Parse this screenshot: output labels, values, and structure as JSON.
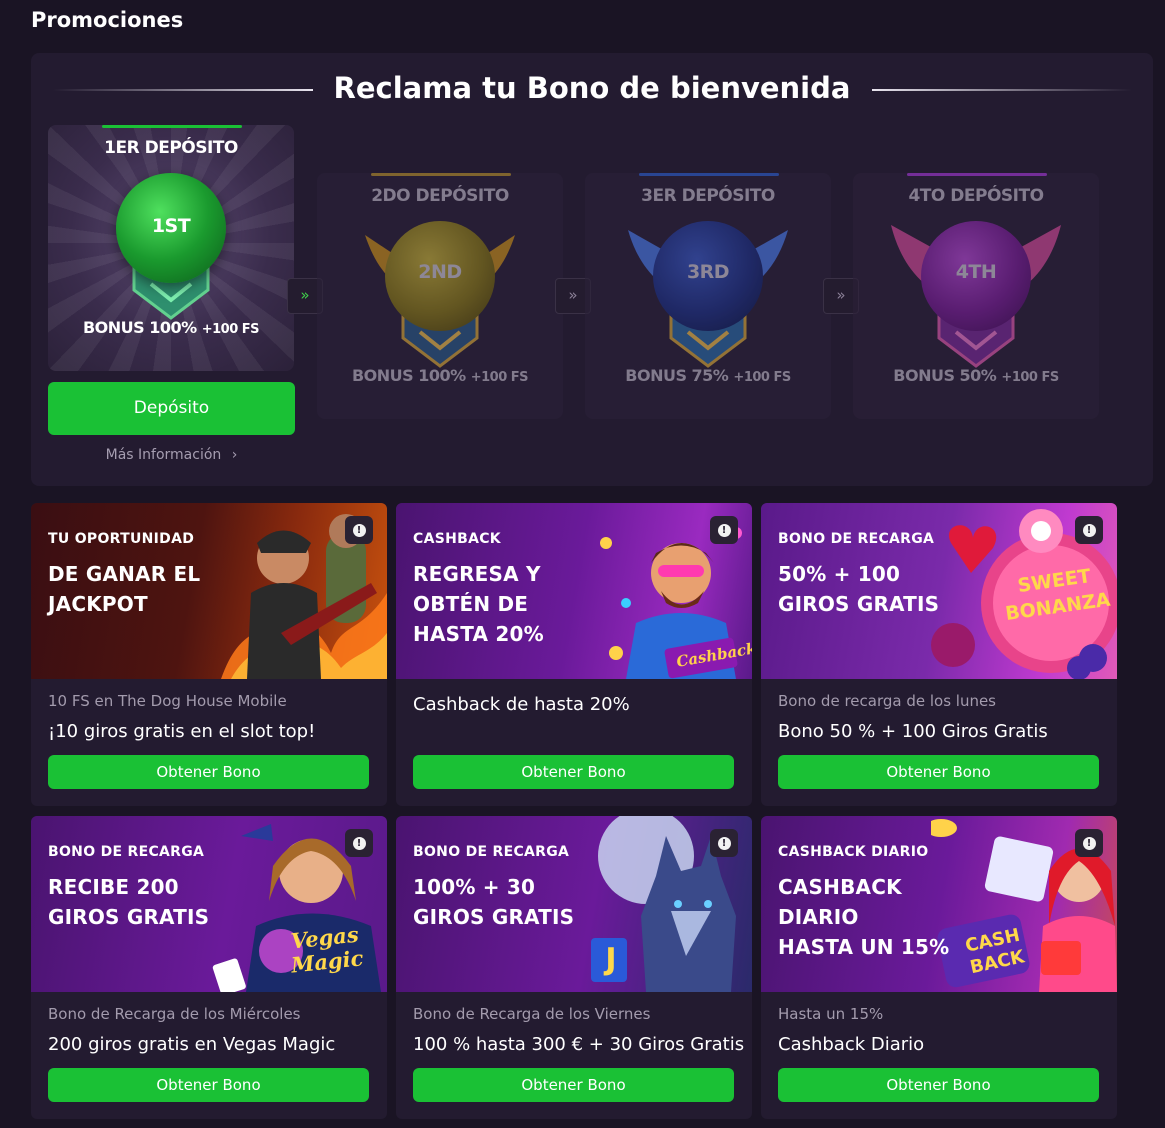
{
  "page": {
    "heading": "Promociones"
  },
  "welcome": {
    "title": "Reclama tu Bono de bienvenida",
    "deposits": [
      {
        "title": "1ER DEPÓSITO",
        "badge": "1ST",
        "bonus": "BONUS 100%",
        "fs": "+100 FS",
        "accent": "#1ac135"
      },
      {
        "title": "2DO DEPÓSITO",
        "badge": "2ND",
        "bonus": "BONUS 100%",
        "fs": "+100 FS",
        "accent": "#b8912e"
      },
      {
        "title": "3ER DEPÓSITO",
        "badge": "3RD",
        "bonus": "BONUS 75%",
        "fs": "+100 FS",
        "accent": "#2d5fd1"
      },
      {
        "title": "4TO DEPÓSITO",
        "badge": "4TH",
        "bonus": "BONUS 50%",
        "fs": "+100 FS",
        "accent": "#a63bd8"
      }
    ],
    "arrow_icon": "»",
    "deposit_button": "Depósito",
    "more_info": "Más Información",
    "more_info_icon": "›"
  },
  "promotions": [
    {
      "kicker": "TU OPORTUNIDAD",
      "headline": "DE GANAR EL\nJACKPOT",
      "sub": "10 FS en The Dog House Mobile",
      "desc": "¡10 giros gratis en el slot top!",
      "button": "Obtener Bono"
    },
    {
      "kicker": "CASHBACK",
      "headline": "REGRESA Y\nOBTÉN DE\nHASTA 20%",
      "sub": "",
      "desc": "Cashback de hasta 20%",
      "button": "Obtener Bono",
      "art_text": "Cashback"
    },
    {
      "kicker": "BONO DE RECARGA",
      "headline": "50% + 100\nGIROS GRATIS",
      "sub": "Bono de recarga de los lunes",
      "desc": "Bono 50 % + 100 Giros Gratis",
      "button": "Obtener Bono",
      "art_text": "SWEET BONANZA"
    },
    {
      "kicker": "BONO DE RECARGA",
      "headline": "RECIBE 200\nGIROS GRATIS",
      "sub": "Bono de Recarga de los Miércoles",
      "desc": "200 giros gratis en Vegas Magic",
      "button": "Obtener Bono",
      "art_text": "Vegas Magic"
    },
    {
      "kicker": "BONO DE RECARGA",
      "headline": "100% + 30\nGIROS GRATIS",
      "sub": "Bono de Recarga de los Viernes",
      "desc": "100 % hasta 300 € + 30 Giros Gratis",
      "button": "Obtener Bono",
      "art_text": "J"
    },
    {
      "kicker": "CASHBACK DIARIO",
      "headline": "CASHBACK\nDIARIO\nHASTA UN 15%",
      "sub": "Hasta un 15%",
      "desc": "Cashback Diario",
      "button": "Obtener Bono",
      "art_text": "CASH BACK"
    }
  ],
  "info_icon": "!"
}
